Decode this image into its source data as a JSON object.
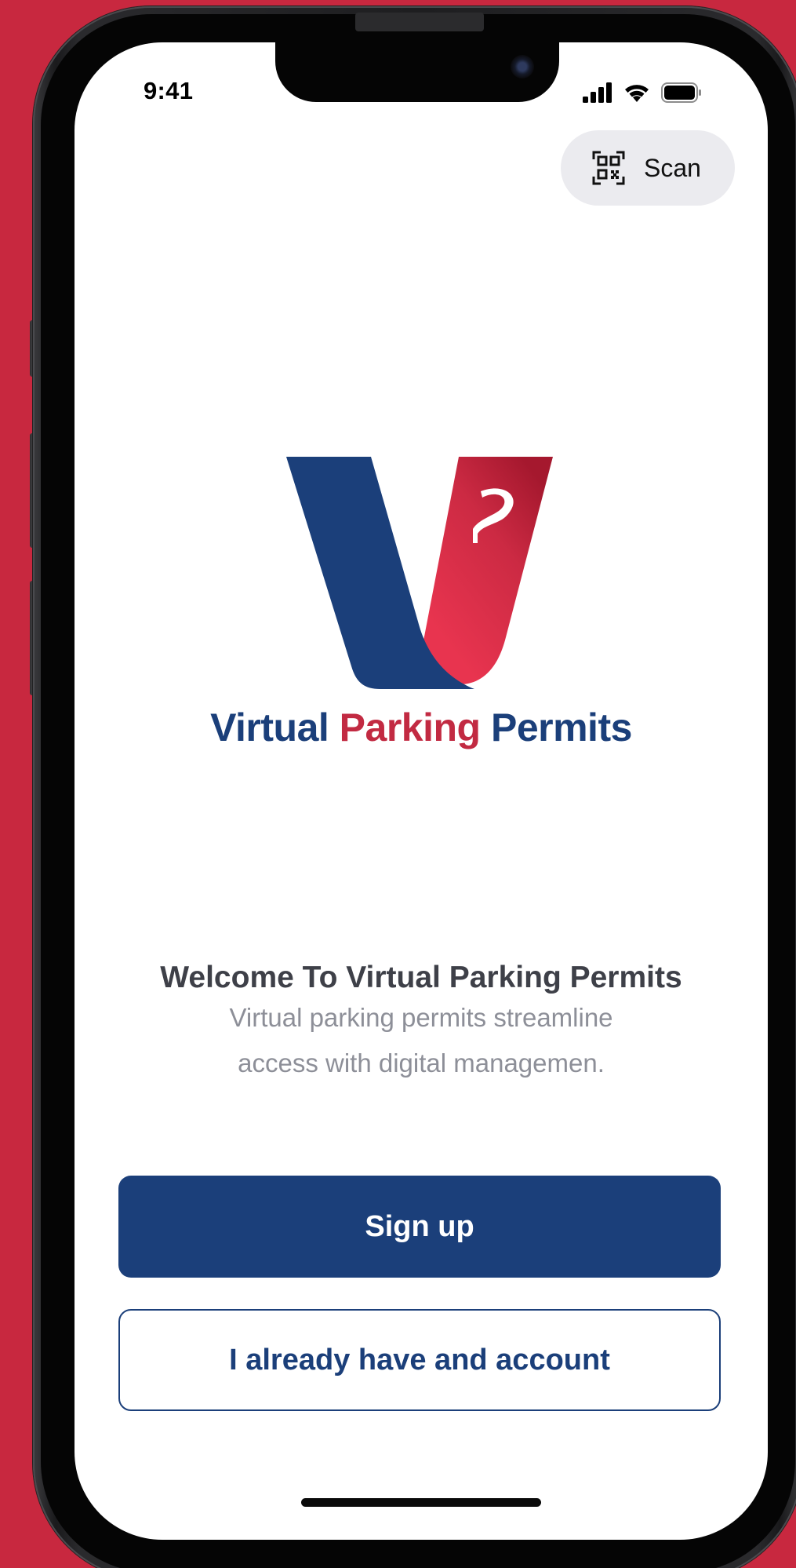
{
  "status_bar": {
    "time": "9:41",
    "icons": [
      "cellular-signal-icon",
      "wifi-icon",
      "battery-icon"
    ]
  },
  "scan_button": {
    "label": "Scan",
    "icon": "qr-code-icon"
  },
  "logo": {
    "word_1": "Virtual",
    "word_2": "Parking",
    "word_3": "Permits",
    "colors": {
      "blue": "#1b3f7a",
      "red": "#c22a42"
    }
  },
  "welcome": {
    "title": "Welcome To Virtual Parking Permits",
    "subtitle": "Virtual parking permits streamline access with digital managemen."
  },
  "actions": {
    "signup_label": "Sign up",
    "login_label": "I already have and account"
  },
  "colors": {
    "background": "#c8283f",
    "primary": "#1b3f7a",
    "accent_red": "#c22a42",
    "title_text": "#3e4048",
    "subtitle_text": "#8d8f98",
    "pill_bg": "#ebebef"
  }
}
